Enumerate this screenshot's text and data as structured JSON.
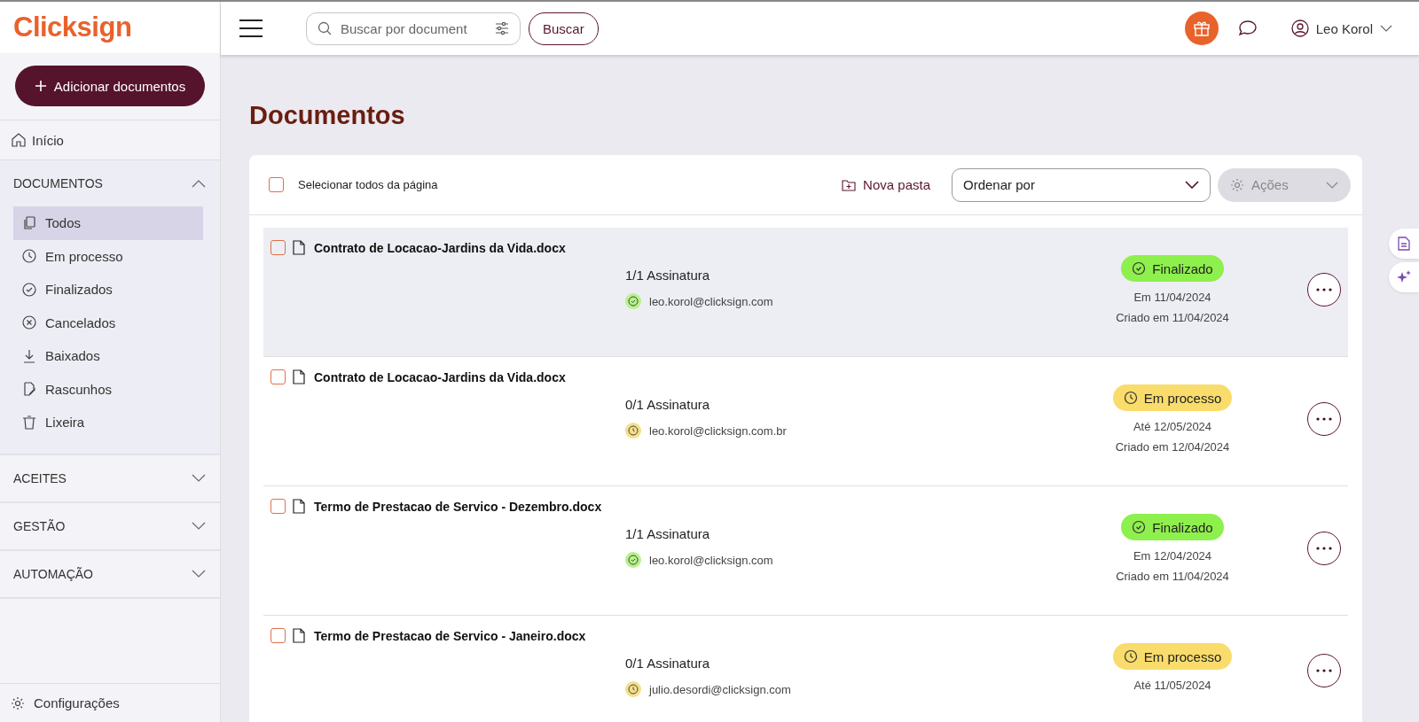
{
  "logo": "Clicksign",
  "add_button": "Adicionar documentos",
  "nav_home": "Início",
  "nav_sections": [
    {
      "label": "DOCUMENTOS",
      "expanded": true,
      "items": [
        {
          "label": "Todos",
          "selected": true
        },
        {
          "label": "Em processo",
          "selected": false
        },
        {
          "label": "Finalizados",
          "selected": false
        },
        {
          "label": "Cancelados",
          "selected": false
        },
        {
          "label": "Baixados",
          "selected": false
        },
        {
          "label": "Rascunhos",
          "selected": false
        },
        {
          "label": "Lixeira",
          "selected": false
        }
      ]
    },
    {
      "label": "ACEITES",
      "expanded": false
    },
    {
      "label": "GESTÃO",
      "expanded": false
    },
    {
      "label": "AUTOMAÇÃO",
      "expanded": false
    }
  ],
  "settings": "Configurações",
  "search": {
    "placeholder": "Buscar por document",
    "button": "Buscar"
  },
  "user": "Leo Korol",
  "page_title": "Documentos",
  "toolbar": {
    "select_all": "Selecionar todos da página",
    "select_all_checked": false,
    "new_folder": "Nova pasta",
    "sort": "Ordenar por",
    "actions": "Ações",
    "actions_disabled": true
  },
  "documents": [
    {
      "name": "Contrato de Locacao-Jardins da Vida.docx",
      "checked": false,
      "highlighted": true,
      "signatures": "1/1 Assinatura",
      "signer": "leo.korol@clicksign.com",
      "status": "Finalizado",
      "kind": "done",
      "date": "Em 11/04/2024",
      "created": "Criado em 11/04/2024"
    },
    {
      "name": "Contrato de Locacao-Jardins da Vida.docx",
      "checked": false,
      "highlighted": false,
      "signatures": "0/1 Assinatura",
      "signer": "leo.korol@clicksign.com.br",
      "status": "Em processo",
      "kind": "pending",
      "date": "Até 12/05/2024",
      "created": "Criado em 12/04/2024"
    },
    {
      "name": "Termo de Prestacao de Servico - Dezembro.docx",
      "checked": false,
      "highlighted": false,
      "signatures": "1/1 Assinatura",
      "signer": "leo.korol@clicksign.com",
      "status": "Finalizado",
      "kind": "done",
      "date": "Em 12/04/2024",
      "created": "Criado em 11/04/2024"
    },
    {
      "name": "Termo de Prestacao de Servico - Janeiro.docx",
      "checked": false,
      "highlighted": false,
      "signatures": "0/1 Assinatura",
      "signer": "julio.desordi@clicksign.com",
      "status": "Em processo",
      "kind": "pending",
      "date": "Até 11/05/2024"
    }
  ]
}
